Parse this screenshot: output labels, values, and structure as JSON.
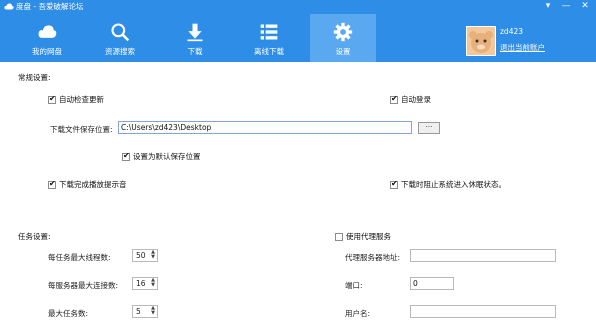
{
  "window": {
    "title": "度盘 - 吾爱破解论坛",
    "controls": {
      "menu": "▾",
      "minimize": "—",
      "close": "✕"
    }
  },
  "nav": {
    "items": [
      {
        "label": "我的网盘",
        "icon": "cloud-icon"
      },
      {
        "label": "资源搜索",
        "icon": "search-icon"
      },
      {
        "label": "下载",
        "icon": "download-icon"
      },
      {
        "label": "离线下载",
        "icon": "list-icon"
      },
      {
        "label": "设置",
        "icon": "gear-icon",
        "active": true
      }
    ]
  },
  "user": {
    "name": "zd423",
    "logout_label": "退出当前账户"
  },
  "general": {
    "title": "常规设置:",
    "auto_update_label": "自动检查更新",
    "auto_login_label": "自动登录",
    "save_path_label": "下载文件保存位置:",
    "save_path_value": "C:\\Users\\zd423\\Desktop",
    "browse_label": "···",
    "set_default_label": "设置为默认保存位置",
    "notify_sound_label": "下载完成播放提示音",
    "prevent_sleep_label": "下载时阻止系统进入休眠状态。"
  },
  "task": {
    "title": "任务设置:",
    "max_threads_label": "每任务最大线程数:",
    "max_threads_value": "50",
    "max_conn_label": "每服务器最大连接数:",
    "max_conn_value": "16",
    "max_tasks_label": "最大任务数:",
    "max_tasks_value": "5"
  },
  "proxy": {
    "use_proxy_label": "使用代理服务",
    "server_label": "代理服务器地址:",
    "server_value": "",
    "port_label": "端口:",
    "port_value": "0",
    "username_label": "用户名:",
    "username_value": ""
  },
  "colors": {
    "header_bg": "#2e8de6",
    "active_tab_bg": "#5aa8f0"
  }
}
